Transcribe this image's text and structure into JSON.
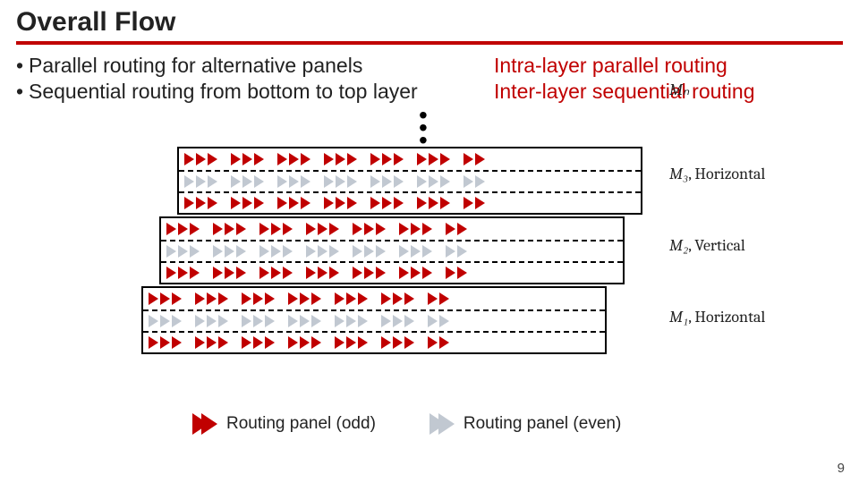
{
  "title": "Overall Flow",
  "bullets": [
    {
      "text": "Parallel routing for alternative panels",
      "tag": "Intra-layer parallel routing"
    },
    {
      "text": "Sequential routing from bottom to top layer",
      "tag": "Inter-layer sequential routing"
    }
  ],
  "layers": {
    "top_label": "Mₙ",
    "labels": [
      {
        "name": "M₃",
        "dir": "Horizontal"
      },
      {
        "name": "M₂",
        "dir": "Vertical"
      },
      {
        "name": "M₁",
        "dir": "Horizontal"
      }
    ]
  },
  "legend": {
    "odd": "Routing panel (odd)",
    "even": "Routing panel (even)"
  },
  "page": "9",
  "chart_data": {
    "type": "diagram",
    "description": "Three stacked rectangular routing layers (M1 bottom, M2 middle, M3 top) shown in staggered isometric offset with vertical ellipsis leading to Mn. Each layer is divided into three horizontal panels by dashed lines. Panels alternate red-chevron (odd) and grey-chevron (even) fill to indicate parallel routing panels.",
    "layers": [
      "M1 Horizontal",
      "M2 Vertical",
      "M3 Horizontal",
      "… Mn"
    ],
    "panel_pattern_per_layer": [
      "odd",
      "even",
      "odd"
    ],
    "intra_layer": "parallel routing across alternating odd/even panels",
    "inter_layer": "sequential routing bottom→top"
  }
}
